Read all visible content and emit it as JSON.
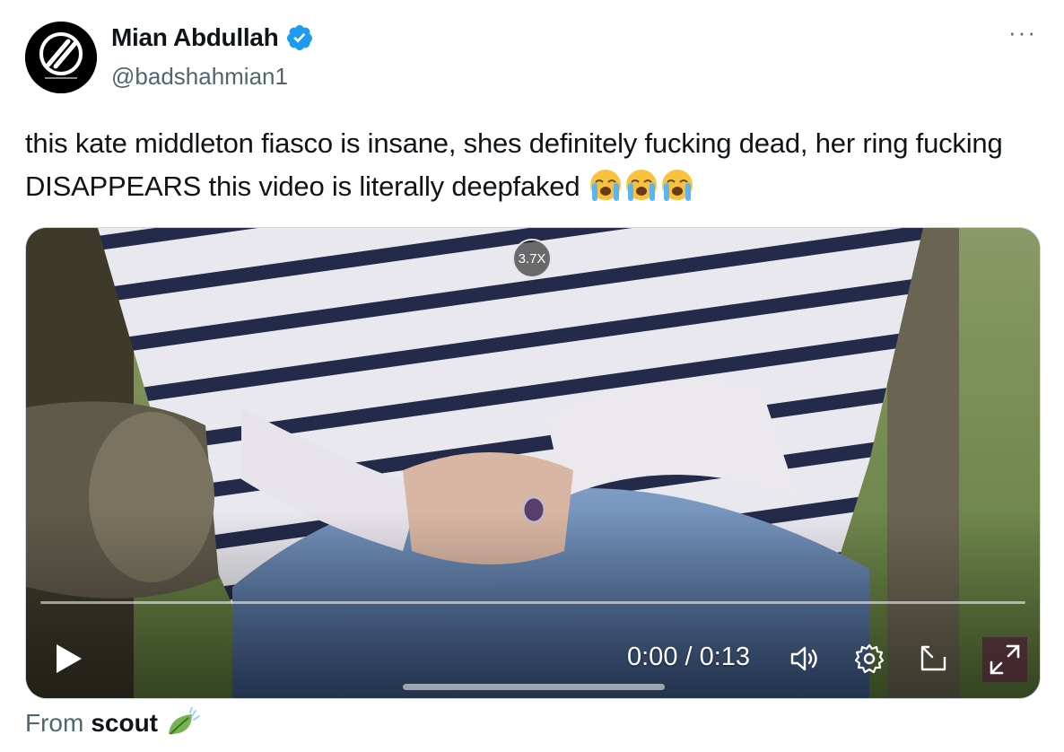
{
  "author": {
    "display_name": "Mian Abdullah",
    "handle": "@badshahmian1",
    "verified_icon": "verified-badge-icon",
    "avatar_icon": "ent-logo-avatar"
  },
  "more_label": "···",
  "tweet": {
    "text": "this kate middleton fiasco is insane, shes definitely fucking dead, her ring fucking DISAPPEARS this video is literally deepfaked",
    "emojis": [
      "loudly-crying-face-icon",
      "loudly-crying-face-icon",
      "loudly-crying-face-icon"
    ]
  },
  "video": {
    "speed_badge": "3.7X",
    "time_display": "0:00 / 0:13",
    "progress_fraction": 0.0,
    "controls": [
      "play-icon",
      "volume-icon",
      "settings-icon",
      "pip-icon",
      "fullscreen-icon"
    ]
  },
  "source": {
    "prefix": "From",
    "name": "scout",
    "icon": "leaf-icon"
  },
  "colors": {
    "text_primary": "#0f1419",
    "text_secondary": "#536471",
    "verified_blue": "#1d9bf0",
    "border": "#cfd9de"
  }
}
